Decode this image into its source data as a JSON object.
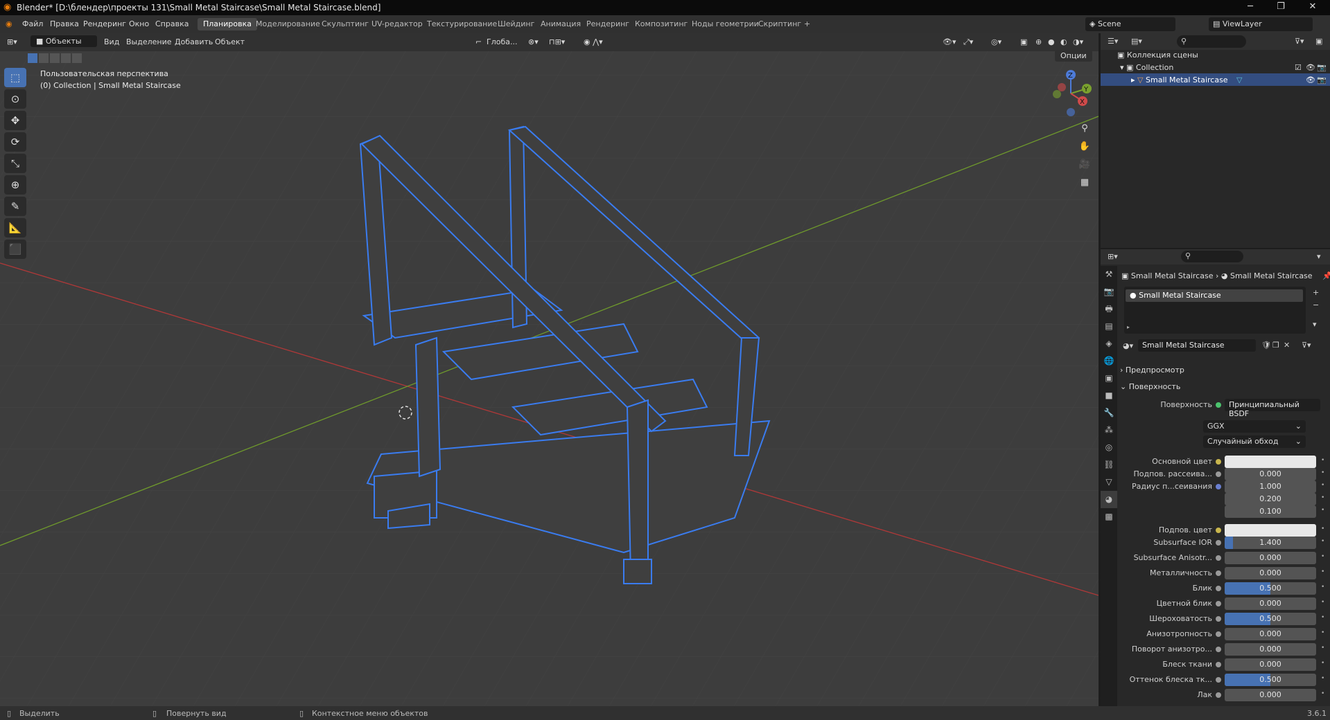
{
  "window": {
    "title": "Blender* [D:\\блендер\\проекты 131\\Small Metal Staircase\\Small Metal Staircase.blend]",
    "controls": [
      "─",
      "❐",
      "✕"
    ]
  },
  "menus": [
    "Файл",
    "Правка",
    "Рендеринг",
    "Окно",
    "Справка"
  ],
  "workspaces": [
    {
      "label": "Планировка",
      "active": true
    },
    {
      "label": "Моделирование"
    },
    {
      "label": "Скульптинг"
    },
    {
      "label": "UV-редактор"
    },
    {
      "label": "Текстурирование"
    },
    {
      "label": "Шейдинг"
    },
    {
      "label": "Анимация"
    },
    {
      "label": "Рендеринг"
    },
    {
      "label": "Композитинг"
    },
    {
      "label": "Ноды геометрии"
    },
    {
      "label": "Скриптинг"
    },
    {
      "label": "+"
    }
  ],
  "scene": {
    "name": "Scene",
    "view_layer": "ViewLayer"
  },
  "viewport": {
    "mode": "Объекты",
    "menu": [
      "Вид",
      "Выделение",
      "Добавить",
      "Объект"
    ],
    "orientation": "Глоба...",
    "options": "Опции",
    "overlay_line1": "Пользовательская перспектива",
    "overlay_line2": "(0) Collection | Small Metal Staircase",
    "gizmo_axes": [
      "Z",
      "Y",
      "X"
    ],
    "tools": [
      "select-box",
      "cursor",
      "move",
      "rotate",
      "scale",
      "transform",
      "annotate",
      "measure",
      "add-cube"
    ],
    "nav_icons": [
      "zoom",
      "pan",
      "camera",
      "grid"
    ],
    "object_color": "#3a7cf0",
    "x_axis_color": "#b03838",
    "y_axis_color": "#6f9a2c"
  },
  "outliner": {
    "root": "Коллекция сцены",
    "collection": "Collection",
    "object": "Small Metal Staircase"
  },
  "properties": {
    "breadcrumb_obj": "Small Metal Staircase",
    "breadcrumb_mat": "Small Metal Staircase",
    "material_slot": "Small Metal Staircase",
    "material_name": "Small Metal Staircase",
    "preview": "Предпросмотр",
    "surface_section": "Поверхность",
    "surface_label": "Поверхность",
    "surface_value": "Принципиальный BSDF",
    "distribution": "GGX",
    "subsurface_method": "Случайный обход",
    "rows": [
      {
        "label": "Основной цвет",
        "type": "color",
        "dot": "yellow"
      },
      {
        "label": "Подпов. рассеива...",
        "value": "0.000",
        "dot": "gray",
        "fill": 0
      },
      {
        "label": "Радиус п...сеивания",
        "value": "1.000",
        "dot": "blue",
        "fill": 0
      },
      {
        "label": "",
        "value": "0.200",
        "fill": 0
      },
      {
        "label": "",
        "value": "0.100",
        "fill": 0
      },
      {
        "label": "Подпов. цвет",
        "type": "color",
        "dot": "yellow"
      },
      {
        "label": "Subsurface IOR",
        "value": "1.400",
        "dot": "gray",
        "fill": 0.09
      },
      {
        "label": "Subsurface Anisotr...",
        "value": "0.000",
        "dot": "gray",
        "fill": 0
      },
      {
        "label": "Металличность",
        "value": "0.000",
        "dot": "gray",
        "fill": 0
      },
      {
        "label": "Блик",
        "value": "0.500",
        "dot": "gray",
        "fill": 0.5
      },
      {
        "label": "Цветной блик",
        "value": "0.000",
        "dot": "gray",
        "fill": 0
      },
      {
        "label": "Шероховатость",
        "value": "0.500",
        "dot": "gray",
        "fill": 0.5
      },
      {
        "label": "Анизотропность",
        "value": "0.000",
        "dot": "gray",
        "fill": 0
      },
      {
        "label": "Поворот анизотро...",
        "value": "0.000",
        "dot": "gray",
        "fill": 0
      },
      {
        "label": "Блеск ткани",
        "value": "0.000",
        "dot": "gray",
        "fill": 0
      },
      {
        "label": "Оттенок блеска тк...",
        "value": "0.500",
        "dot": "gray",
        "fill": 0.5
      },
      {
        "label": "Лак",
        "value": "0.000",
        "dot": "gray",
        "fill": 0
      }
    ]
  },
  "statusbar": {
    "select": "Выделить",
    "rotate": "Повернуть вид",
    "context": "Контекстное меню объектов",
    "version": "3.6.1"
  }
}
